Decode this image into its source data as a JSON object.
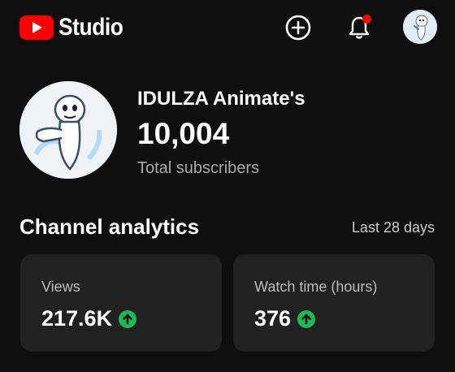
{
  "header": {
    "logo_text": "Studio",
    "brand_color": "#ff0000"
  },
  "channel": {
    "name": "IDULZA Animate's",
    "subscriber_count": "10,004",
    "subscriber_label": "Total subscribers"
  },
  "analytics": {
    "title": "Channel analytics",
    "period": "Last 28 days",
    "cards": [
      {
        "label": "Views",
        "value": "217.6K",
        "trend": "up",
        "trend_color": "#1db954"
      },
      {
        "label": "Watch time (hours)",
        "value": "376",
        "trend": "up",
        "trend_color": "#1db954"
      }
    ]
  },
  "icons": {
    "create": "create-plus-icon",
    "notifications": "bell-icon",
    "trend": "arrow-up-circle-icon"
  }
}
